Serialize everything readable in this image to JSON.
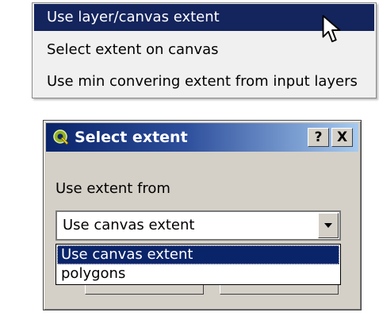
{
  "context_menu": {
    "items": [
      {
        "label": "Use layer/canvas extent",
        "selected": true
      },
      {
        "label": "Select extent on canvas",
        "selected": false
      },
      {
        "label": "Use min convering extent from input layers",
        "selected": false
      }
    ]
  },
  "dialog": {
    "title": "Select extent",
    "help_button": "?",
    "close_button": "X",
    "label": "Use extent from",
    "combo": {
      "value": "Use canvas extent",
      "options": [
        "Use canvas extent",
        "polygons"
      ],
      "highlighted_index": 0
    }
  },
  "colors": {
    "menu_highlight": "#14245c",
    "titlebar_start": "#0a246a",
    "titlebar_end": "#a6caf0",
    "dialog_face": "#d4d0c8"
  },
  "icons": {
    "cursor": "mouse-pointer-arrow",
    "app": "qgis-logo"
  }
}
